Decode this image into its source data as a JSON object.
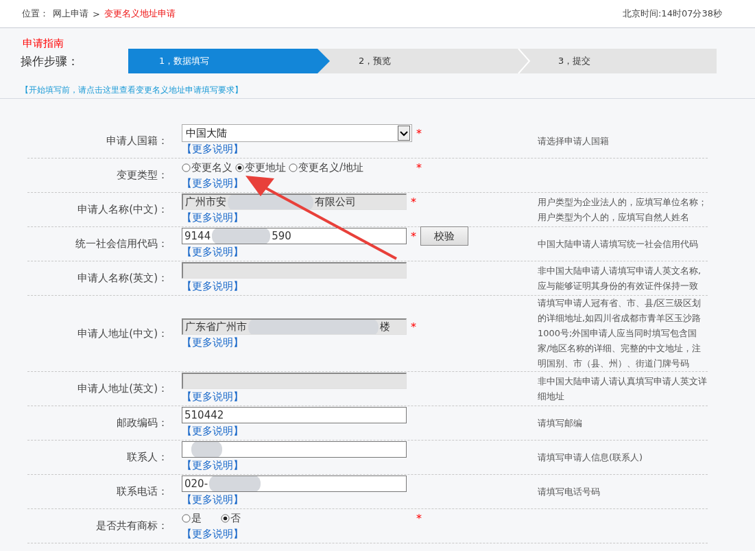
{
  "breadcrumb": {
    "label": "位置：",
    "items": [
      {
        "text": "网上申请",
        "current": false
      },
      {
        "text": "变更名义地址申请",
        "current": true
      }
    ],
    "separator": ">"
  },
  "clock": "北京时间:14时07分38秒",
  "guide_link": "申请指南",
  "steps_label": "操作步骤：",
  "steps": [
    {
      "label": "1，数据填写",
      "selected": true
    },
    {
      "label": "2，预览",
      "selected": false
    },
    {
      "label": "3，提交",
      "selected": false
    }
  ],
  "notice_link": "【开始填写前，请点击这里查看变更名义地址申请填写要求】",
  "rows": [
    {
      "label": "申请人国籍：",
      "kind": "select",
      "value": "中国大陆",
      "required": "*",
      "more": "【更多说明】",
      "hint": "请选择申请人国籍"
    },
    {
      "label": "变更类型：",
      "kind": "radio",
      "options": [
        {
          "text": "变更名义",
          "selected": false
        },
        {
          "text": "变更地址",
          "selected": true
        },
        {
          "text": "变更名义/地址",
          "selected": false
        }
      ],
      "required": "*",
      "more": "【更多说明】"
    },
    {
      "label": "申请人名称(中文)：",
      "kind": "text",
      "disabled": true,
      "value": "广州市安",
      "redacted": true,
      "value_end": "有限公司",
      "required": "*",
      "more": "【更多说明】",
      "hint": "用户类型为企业法人的，应填写单位名称；用户类型为个人的，应填写自然人姓名"
    },
    {
      "label": "统一社会信用代码：",
      "kind": "text",
      "disabled": false,
      "value": "9144",
      "redacted": true,
      "value_end": "590",
      "required": "*",
      "button": "校验",
      "more": "【更多说明】",
      "hint": "中国大陆申请人请填写统一社会信用代码"
    },
    {
      "label": "申请人名称(英文)：",
      "kind": "text",
      "disabled": true,
      "more": "【更多说明】",
      "hint": "非中国大陆申请人请填写申请人英文名称,应与能够证明其身份的有效证件保持一致"
    },
    {
      "label": "申请人地址(中文)：",
      "kind": "text",
      "disabled": true,
      "value": "广东省广州市",
      "redacted": true,
      "value_end": "楼",
      "required": "*",
      "more": "【更多说明】",
      "hint": "请填写申请人冠有省、市、县/区三级区划的详细地址,如四川省成都市青羊区玉沙路1000号;外国申请人应当同时填写包含国家/地区名称的详细、完整的中文地址，注明国别、市（县、州）、街道门牌号码"
    },
    {
      "label": "申请人地址(英文)：",
      "kind": "text",
      "disabled": true,
      "more": "【更多说明】",
      "hint": "非中国大陆申请人请认真填写申请人英文详细地址"
    },
    {
      "label": "邮政编码：",
      "kind": "text",
      "disabled": false,
      "value": "510442",
      "more": "【更多说明】",
      "hint": "请填写邮编"
    },
    {
      "label": "联系人：",
      "kind": "text",
      "disabled": false,
      "redacted": true,
      "more": "【更多说明】",
      "hint": "请填写申请人信息(联系人)"
    },
    {
      "label": "联系电话：",
      "kind": "text",
      "disabled": false,
      "value": "020-",
      "redacted": true,
      "more": "【更多说明】",
      "hint": "请填写电话号码"
    },
    {
      "label": "是否共有商标：",
      "kind": "radio",
      "options": [
        {
          "text": "是",
          "selected": false
        },
        {
          "text": "否",
          "selected": true
        }
      ],
      "required": "*",
      "more": "【更多说明】"
    }
  ]
}
